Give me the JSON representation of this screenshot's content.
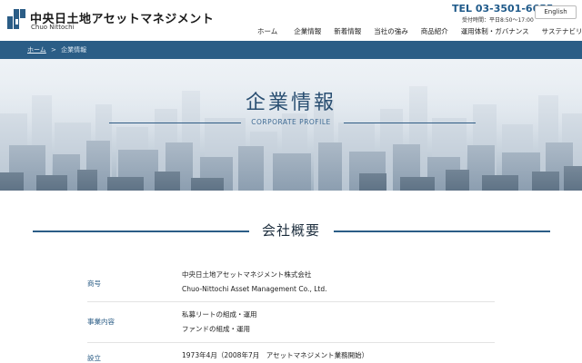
{
  "header": {
    "company_name": "中央日土地アセットマネジメント",
    "company_sub": "Chuo Nittochi",
    "tel": "TEL 03-3501-6655",
    "hours": "受付時間：平日8:50～17:00",
    "lang_button": "English",
    "nav": [
      "ホーム",
      "企業情報",
      "新着情報",
      "当社の強み",
      "商品紹介",
      "運用体制・ガバナンス",
      "サステナビリティ"
    ]
  },
  "breadcrumb": {
    "home": "ホーム",
    "separator": ">",
    "current": "企業情報"
  },
  "hero": {
    "title": "企業情報",
    "subtitle": "CORPORATE PROFILE"
  },
  "section": {
    "title": "会社概要",
    "rows": [
      {
        "label": "商号",
        "lines": [
          "中央日土地アセットマネジメント株式会社",
          "Chuo-Nittochi Asset Management Co., Ltd."
        ]
      },
      {
        "label": "事業内容",
        "lines": [
          "私募リートの組成・運用",
          "ファンドの組成・運用"
        ]
      },
      {
        "label": "設立",
        "lines": [
          "1973年4月（2008年7月　アセットマネジメント業務開始）"
        ]
      }
    ]
  },
  "colors": {
    "brand": "#2b5d86",
    "tel": "#1f5a8a"
  }
}
